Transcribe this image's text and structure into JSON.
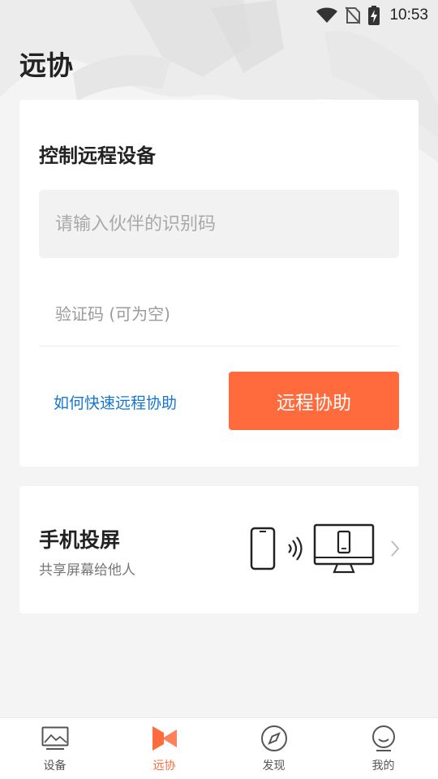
{
  "status_bar": {
    "time": "10:53",
    "icons": [
      "wifi-icon",
      "no-sim-icon",
      "battery-charging-icon"
    ]
  },
  "page": {
    "title": "远协"
  },
  "remote_card": {
    "title": "控制远程设备",
    "id_input": {
      "placeholder": "请输入伙伴的识别码",
      "value": ""
    },
    "code_input": {
      "placeholder": "验证码 (可为空)",
      "value": ""
    },
    "help_link": "如何快速远程协助",
    "assist_button": "远程协助"
  },
  "cast_card": {
    "title": "手机投屏",
    "subtitle": "共享屏幕给他人",
    "icons": [
      "phone-icon",
      "signal-waves-icon",
      "monitor-icon",
      "chevron-right-icon"
    ]
  },
  "bottom_nav": {
    "items": [
      {
        "label": "设备",
        "icon": "devices-image-icon",
        "active": false
      },
      {
        "label": "远协",
        "icon": "remote-assist-logo-icon",
        "active": true
      },
      {
        "label": "发现",
        "icon": "compass-icon",
        "active": false
      },
      {
        "label": "我的",
        "icon": "profile-face-icon",
        "active": false
      }
    ]
  },
  "colors": {
    "accent": "#ff6b3d",
    "link": "#1677d2",
    "background": "#f4f4f4",
    "card": "#ffffff"
  }
}
